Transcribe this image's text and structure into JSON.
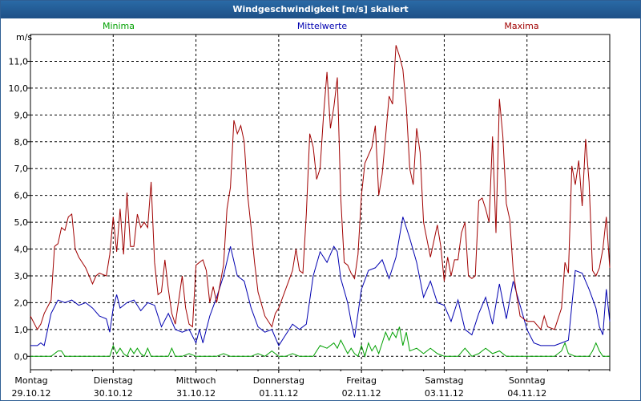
{
  "window": {
    "title": "Windgeschwindigkeit [m/s] skaliert"
  },
  "chart_data": {
    "type": "line",
    "title": "Windgeschwindigkeit [m/s] skaliert",
    "ylabel": "m/s",
    "xlabel": "",
    "ylim": [
      -0.5,
      12.0
    ],
    "yticks": [
      0.0,
      1.0,
      2.0,
      3.0,
      4.0,
      5.0,
      6.0,
      7.0,
      8.0,
      9.0,
      10.0,
      11.0
    ],
    "ytick_labels": [
      "0,0",
      "1,0",
      "2,0",
      "3,0",
      "4,0",
      "5,0",
      "6,0",
      "7,0",
      "8,0",
      "9,0",
      "10,0",
      "11,0"
    ],
    "x_range_hours": [
      0,
      168
    ],
    "grid": true,
    "days": [
      {
        "hour": 0,
        "weekday": "Montag",
        "date": "29.10.12"
      },
      {
        "hour": 24,
        "weekday": "Dienstag",
        "date": "30.10.12"
      },
      {
        "hour": 48,
        "weekday": "Mittwoch",
        "date": "31.10.12"
      },
      {
        "hour": 72,
        "weekday": "Donnerstag",
        "date": "01.11.12"
      },
      {
        "hour": 96,
        "weekday": "Freitag",
        "date": "02.11.12"
      },
      {
        "hour": 120,
        "weekday": "Samstag",
        "date": "03.11.12"
      },
      {
        "hour": 144,
        "weekday": "Sonntag",
        "date": "04.11.12"
      }
    ],
    "series": [
      {
        "name": "Minima",
        "color": "#00a000",
        "x": [
          0,
          2,
          4,
          6,
          8,
          9,
          10,
          12,
          14,
          16,
          18,
          20,
          22,
          23,
          24,
          25,
          26,
          27,
          28,
          29,
          30,
          31,
          32,
          33,
          34,
          35,
          36,
          38,
          40,
          41,
          42,
          44,
          46,
          48,
          50,
          52,
          54,
          56,
          58,
          60,
          62,
          64,
          66,
          68,
          70,
          72,
          74,
          76,
          78,
          80,
          82,
          84,
          86,
          88,
          89,
          90,
          92,
          93,
          94,
          95,
          96,
          97,
          98,
          99,
          100,
          101,
          102,
          103,
          104,
          105,
          106,
          107,
          108,
          109,
          110,
          112,
          114,
          116,
          118,
          120,
          122,
          124,
          126,
          128,
          130,
          132,
          134,
          136,
          138,
          140,
          142,
          144,
          146,
          148,
          150,
          152,
          154,
          155,
          156,
          158,
          160,
          162,
          163,
          164,
          165,
          166,
          167,
          168
        ],
        "y": [
          0,
          0,
          0,
          0,
          0.2,
          0.2,
          0,
          0,
          0,
          0,
          0,
          0,
          0,
          0,
          0.4,
          0.1,
          0.3,
          0.1,
          0,
          0.3,
          0.1,
          0.3,
          0.1,
          0,
          0.3,
          0,
          0,
          0,
          0,
          0.3,
          0,
          0,
          0.1,
          0,
          0,
          0,
          0,
          0.1,
          0,
          0,
          0,
          0,
          0.1,
          0,
          0.2,
          0,
          0,
          0.1,
          0,
          0,
          0,
          0.4,
          0.3,
          0.5,
          0.3,
          0.6,
          0.1,
          0.3,
          0.1,
          0,
          0.4,
          0,
          0.5,
          0.2,
          0.4,
          0.1,
          0.5,
          0.9,
          0.6,
          0.9,
          0.7,
          1.1,
          0.4,
          0.9,
          0.2,
          0.3,
          0.1,
          0.3,
          0.1,
          0,
          0,
          0,
          0.3,
          0,
          0.1,
          0.3,
          0.1,
          0.2,
          0,
          0,
          0,
          0,
          0,
          0,
          0,
          0,
          0.2,
          0.5,
          0.1,
          0,
          0,
          0,
          0.2,
          0.5,
          0.2,
          0,
          0,
          0
        ]
      },
      {
        "name": "Mittelwerte",
        "color": "#0000b0",
        "x": [
          0,
          2,
          3,
          4,
          6,
          8,
          10,
          12,
          14,
          16,
          18,
          20,
          22,
          23,
          24,
          25,
          26,
          28,
          30,
          32,
          34,
          36,
          38,
          40,
          42,
          44,
          46,
          48,
          49,
          50,
          52,
          54,
          56,
          58,
          60,
          62,
          64,
          66,
          68,
          70,
          72,
          74,
          76,
          78,
          80,
          82,
          84,
          86,
          88,
          89,
          90,
          92,
          93,
          94,
          96,
          98,
          100,
          102,
          104,
          106,
          108,
          110,
          112,
          114,
          116,
          118,
          120,
          122,
          124,
          126,
          128,
          130,
          132,
          134,
          136,
          138,
          140,
          142,
          144,
          146,
          148,
          150,
          152,
          154,
          156,
          158,
          160,
          162,
          164,
          165,
          166,
          167,
          168
        ],
        "y": [
          0.4,
          0.4,
          0.5,
          0.4,
          1.6,
          2.1,
          2.0,
          2.1,
          1.9,
          2.0,
          1.8,
          1.5,
          1.4,
          0.9,
          1.8,
          2.3,
          1.8,
          2.0,
          2.1,
          1.7,
          2.0,
          1.9,
          1.1,
          1.6,
          1.0,
          0.9,
          1.0,
          0.5,
          1.0,
          0.5,
          1.5,
          2.2,
          3.0,
          4.1,
          3.0,
          2.8,
          1.8,
          1.1,
          0.9,
          1.0,
          0.4,
          0.8,
          1.2,
          1.0,
          1.2,
          3.0,
          3.9,
          3.5,
          4.1,
          3.9,
          2.9,
          2.0,
          1.3,
          0.7,
          2.5,
          3.2,
          3.3,
          3.6,
          2.9,
          3.7,
          5.2,
          4.4,
          3.5,
          2.2,
          2.8,
          2.0,
          1.9,
          1.3,
          2.1,
          1.0,
          0.8,
          1.6,
          2.2,
          1.2,
          2.7,
          1.4,
          2.8,
          1.9,
          1.0,
          0.5,
          0.4,
          0.4,
          0.4,
          0.5,
          0.6,
          3.2,
          3.1,
          2.5,
          1.8,
          1.1,
          0.8,
          2.5,
          1.3
        ]
      },
      {
        "name": "Maxima",
        "color": "#a00000",
        "x": [
          0,
          2,
          3,
          4,
          6,
          7,
          8,
          9,
          10,
          11,
          12,
          13,
          14,
          16,
          18,
          19,
          20,
          22,
          23,
          24,
          25,
          26,
          27,
          28,
          29,
          30,
          31,
          32,
          33,
          34,
          35,
          36,
          37,
          38,
          39,
          40,
          41,
          42,
          44,
          45,
          46,
          47,
          48,
          49,
          50,
          51,
          52,
          53,
          54,
          55,
          56,
          57,
          58,
          59,
          60,
          61,
          62,
          63,
          64,
          65,
          66,
          68,
          70,
          71,
          72,
          74,
          76,
          77,
          78,
          79,
          80,
          81,
          82,
          83,
          84,
          85,
          86,
          87,
          88,
          89,
          90,
          91,
          92,
          93,
          94,
          95,
          96,
          97,
          98,
          99,
          100,
          101,
          102,
          103,
          104,
          105,
          106,
          107,
          108,
          109,
          110,
          111,
          112,
          113,
          114,
          116,
          118,
          119,
          120,
          121,
          122,
          123,
          124,
          125,
          126,
          127,
          128,
          129,
          130,
          131,
          132,
          133,
          134,
          135,
          136,
          137,
          138,
          139,
          140,
          141,
          142,
          143,
          144,
          146,
          148,
          149,
          150,
          152,
          154,
          155,
          156,
          157,
          158,
          159,
          160,
          161,
          162,
          163,
          164,
          165,
          166,
          167,
          168
        ],
        "y": [
          1.5,
          1.0,
          1.2,
          1.6,
          2.1,
          4.1,
          4.2,
          4.8,
          4.7,
          5.2,
          5.3,
          4.0,
          3.7,
          3.3,
          2.7,
          3.0,
          3.1,
          3.0,
          3.8,
          5.2,
          3.9,
          5.5,
          3.8,
          6.1,
          4.1,
          4.1,
          5.3,
          4.8,
          5.0,
          4.8,
          6.5,
          3.5,
          2.3,
          2.4,
          3.6,
          2.5,
          1.6,
          1.2,
          3.0,
          1.8,
          1.2,
          1.1,
          3.4,
          3.5,
          3.6,
          3.2,
          2.0,
          2.6,
          2.0,
          2.7,
          3.4,
          5.5,
          6.3,
          8.8,
          8.3,
          8.6,
          8.0,
          6.0,
          4.8,
          3.5,
          2.4,
          1.5,
          1.1,
          1.6,
          1.8,
          2.5,
          3.2,
          4.0,
          3.2,
          3.1,
          5.3,
          8.3,
          7.8,
          6.6,
          7.0,
          9.0,
          10.6,
          8.5,
          9.3,
          10.4,
          5.9,
          3.5,
          3.4,
          3.1,
          2.9,
          3.8,
          6.0,
          7.2,
          7.5,
          7.8,
          8.6,
          6.0,
          6.8,
          8.2,
          9.7,
          9.4,
          11.6,
          11.2,
          10.7,
          9.3,
          7.0,
          6.4,
          8.5,
          7.6,
          5.0,
          3.7,
          4.9,
          4.1,
          2.8,
          3.7,
          3.0,
          3.6,
          3.6,
          4.6,
          5.0,
          3.0,
          2.9,
          3.0,
          5.8,
          5.9,
          5.5,
          5.0,
          8.2,
          4.6,
          9.6,
          8.2,
          5.7,
          5.1,
          3.2,
          2.3,
          1.5,
          1.4,
          1.3,
          1.3,
          1.0,
          1.5,
          1.1,
          1.0,
          1.8,
          3.5,
          3.1,
          7.1,
          6.4,
          7.3,
          5.6,
          8.1,
          6.5,
          3.2,
          3.0,
          3.3,
          4.0,
          5.2,
          3.3
        ]
      }
    ]
  }
}
